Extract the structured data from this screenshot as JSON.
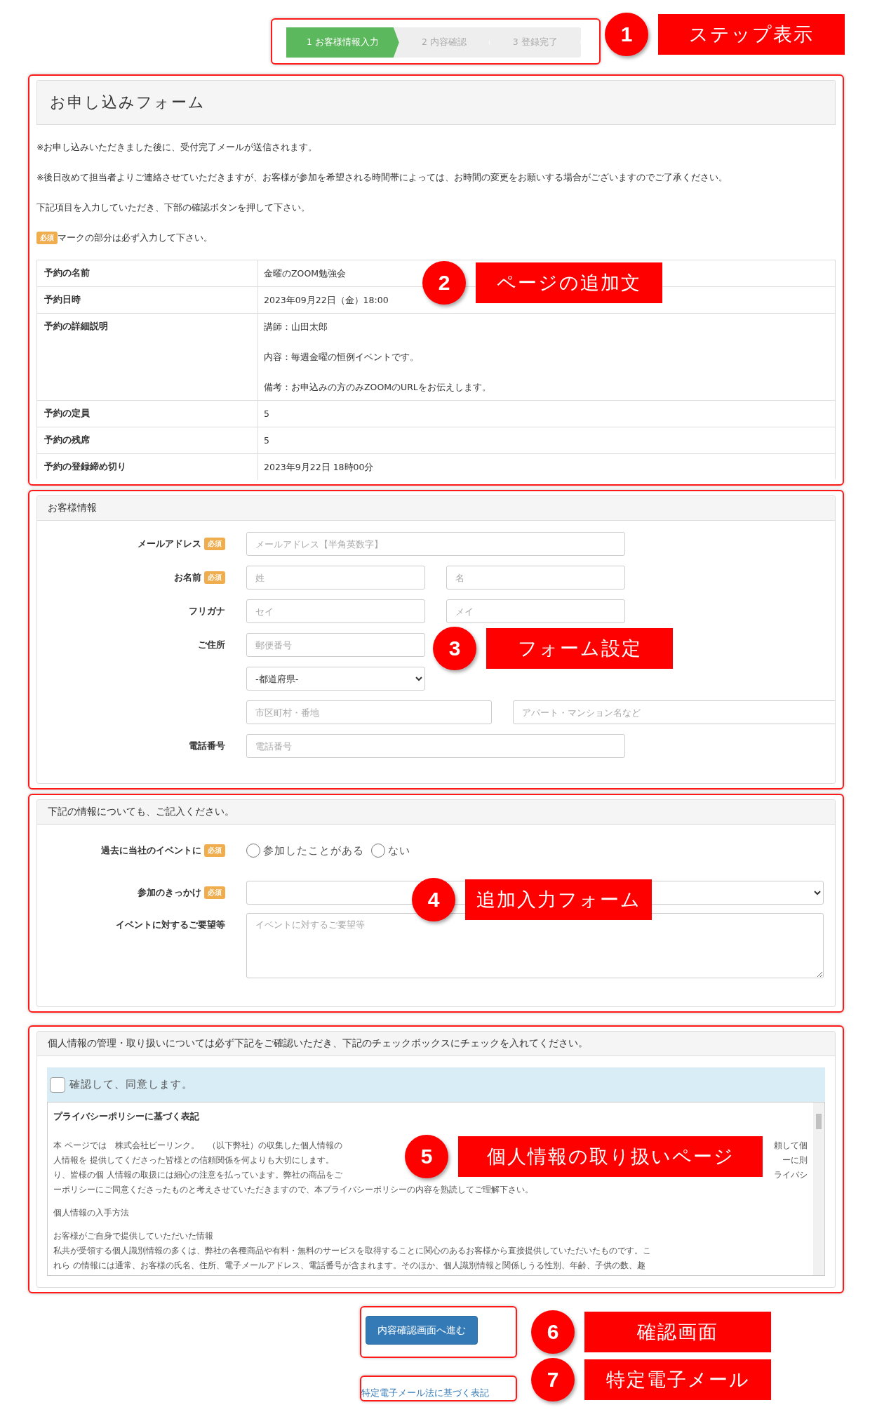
{
  "steps": {
    "items": [
      {
        "label": "1 お客様情報入力",
        "selected": true
      },
      {
        "label": "2 内容確認",
        "selected": false
      },
      {
        "label": "3 登録完了",
        "selected": false
      }
    ],
    "callout": {
      "number": "1",
      "label": "ステップ表示"
    }
  },
  "application_form": {
    "title": "お申し込みフォーム",
    "notes": [
      "※お申し込みいただきました後に、受付完了メールが送信されます。",
      "※後日改めて担当者よりご連絡させていただきますが、お客様が参加を希望される時間帯によっては、お時間の変更をお願いする場合がございますのでご了承ください。",
      "下記項目を入力していただき、下部の確認ボタンを押して下さい。"
    ],
    "required_note": {
      "badge": "必須",
      "text": "マークの部分は必ず入力して下さい。"
    },
    "table": [
      {
        "label": "予約の名前",
        "values": [
          "金曜のZOOM勉強会"
        ]
      },
      {
        "label": "予約日時",
        "values": [
          "2023年09月22日（金）18:00"
        ]
      },
      {
        "label": "予約の詳細説明",
        "values": [
          "講師：山田太郎",
          "内容：毎週金曜の恒例イベントです。",
          "備考：お申込みの方のみZOOMのURLをお伝えします。"
        ]
      },
      {
        "label": "予約の定員",
        "values": [
          "5"
        ]
      },
      {
        "label": "予約の残席",
        "values": [
          "5"
        ]
      },
      {
        "label": "予約の登録締め切り",
        "values": [
          "2023年9月22日 18時00分"
        ]
      }
    ],
    "callout": {
      "number": "2",
      "label": "ページの追加文"
    }
  },
  "customer_info": {
    "title": "お客様情報",
    "fields": [
      {
        "label": "メールアドレス",
        "badge": "必須",
        "rows": [
          {
            "kind": "standard",
            "inputs": [
              {
                "kind": "text",
                "placeholder": "メールアドレス【半角英数字】"
              }
            ]
          }
        ]
      },
      {
        "label": "お名前",
        "badge": "必須",
        "rows": [
          {
            "kind": "standard",
            "inputs": [
              {
                "kind": "text",
                "placeholder": "姓"
              },
              {
                "kind": "text",
                "placeholder": "名"
              }
            ]
          }
        ]
      },
      {
        "label": "フリガナ",
        "rows": [
          {
            "kind": "standard",
            "inputs": [
              {
                "kind": "text",
                "placeholder": "セイ"
              },
              {
                "kind": "text",
                "placeholder": "メイ"
              }
            ]
          }
        ]
      },
      {
        "label": "ご住所",
        "rows": [
          {
            "kind": "standard",
            "inputs": [
              {
                "kind": "text",
                "placeholder": "郵便番号"
              }
            ]
          },
          {
            "kind": "standard",
            "inputs": [
              {
                "kind": "select",
                "value": "-都道府県-"
              }
            ]
          },
          {
            "kind": "wide",
            "inputs": [
              {
                "kind": "text",
                "placeholder": "市区町村・番地"
              },
              {
                "kind": "text",
                "placeholder": "アパート・マンション名など"
              }
            ]
          }
        ]
      },
      {
        "label": "電話番号",
        "rows": [
          {
            "kind": "standard",
            "inputs": [
              {
                "kind": "text",
                "placeholder": "電話番号"
              }
            ]
          }
        ]
      }
    ],
    "callout": {
      "number": "3",
      "label": "フォーム設定"
    }
  },
  "additional_info": {
    "title": "下記の情報についても、ご記入ください。",
    "fields": [
      {
        "kind": "radio",
        "label": "過去に当社のイベントに",
        "badge": "必須",
        "options": [
          {
            "label": "参加したことがある",
            "selected": false
          },
          {
            "label": "ない",
            "selected": false
          }
        ]
      },
      {
        "kind": "select",
        "label": "参加のきっかけ",
        "badge": "必須"
      },
      {
        "kind": "textarea",
        "label": "イベントに対するご要望等",
        "placeholder": "イベントに対するご要望等"
      }
    ],
    "callout": {
      "number": "4",
      "label": "追加入力フォーム"
    }
  },
  "privacy": {
    "title": "個人情報の管理・取り扱いについては必ず下記をご確認いただき、下記のチェックボックスにチェックを入れてください。",
    "agree": {
      "label": "確認して、同意します。",
      "checked": false
    },
    "policy": {
      "heading": "プライバシーポリシーに基づく表記",
      "paragraphs": [
        {
          "lines": [
            [
              "本 ページでは　株式会社ビーリンク。　（以下弊社）の収集した個人情報の",
              "頼して個"
            ],
            [
              "人情報を 提供してくださった皆様との信頼関係を何よりも大切にします。",
              "ーに則"
            ],
            [
              "り、皆様の個 人情報の取扱には細心の注意を払っています。弊社の商品をご",
              "ライバシ"
            ],
            [
              "ーポリシーにご同意くださったものと考えさせていただきますので、本プライバシーポリシーの内容を熟読してご理解下さい。"
            ]
          ]
        },
        {
          "lines": [
            [
              "個人情報の入手方法"
            ]
          ]
        },
        {
          "lines": [
            [
              "お客様がご自身で提供していただいた情報"
            ],
            [
              "私共が受領する個人識別情報の多くは、弊社の各種商品や有料・無料のサービスを取得することに関心のあるお客様から直接提供していただいたものです。こ"
            ],
            [
              "れら の情報には通常、お客様の氏名、住所、電子メールアドレス、電話番号が含まれます。そのほか、個人識別情報と関係しうる性別、年齢、子供の数、趣"
            ]
          ]
        }
      ]
    },
    "callout": {
      "number": "5",
      "label": "個人情報の取り扱いページ"
    }
  },
  "confirm": {
    "button": "内容確認画面へ進む",
    "callout": {
      "number": "6",
      "label": "確認画面"
    }
  },
  "footer": {
    "link": "特定電子メール法に基づく表記",
    "callout": {
      "number": "7",
      "label": "特定電子メール"
    }
  }
}
